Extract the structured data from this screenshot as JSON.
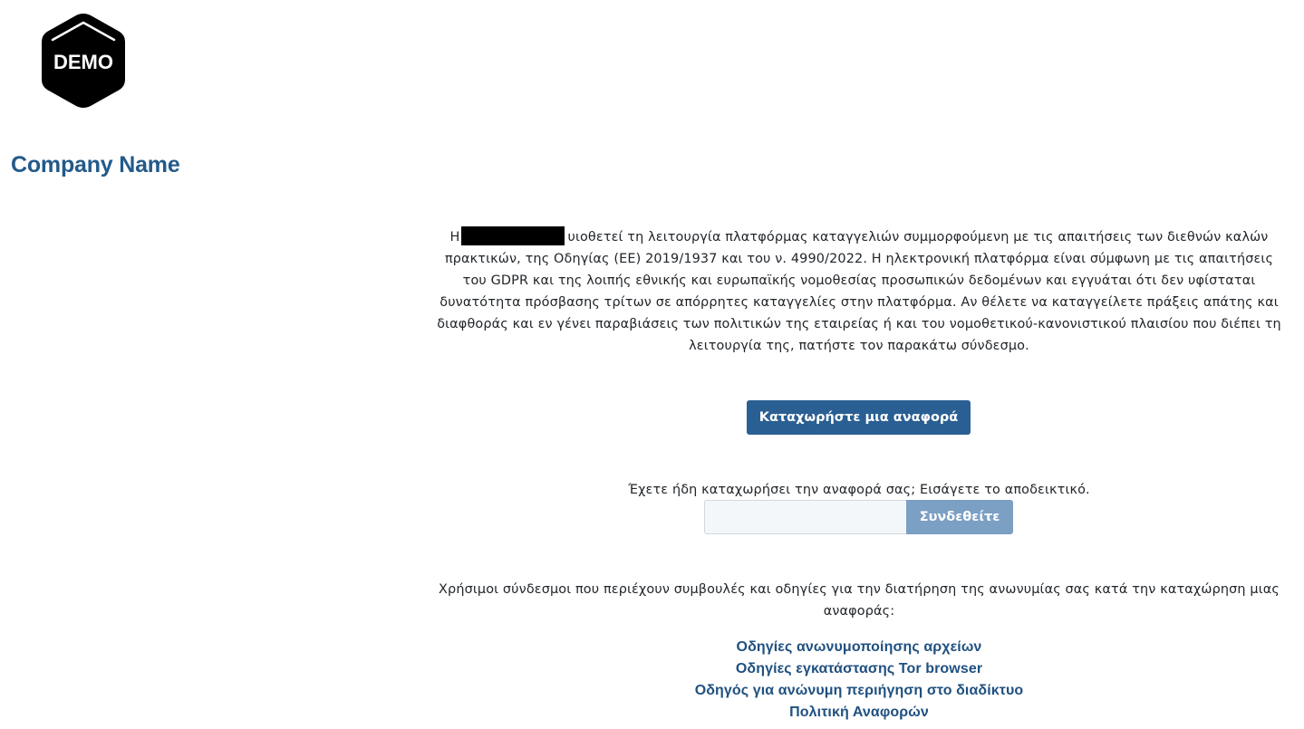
{
  "logo": {
    "text": "DEMO"
  },
  "company": {
    "name": "Company Name"
  },
  "intro": {
    "prefix": "Η",
    "text": "υιοθετεί τη λειτουργία πλατφόρμας καταγγελιών συμμορφούμενη με τις απαιτήσεις των διεθνών καλών πρακτικών, της Οδηγίας (ΕΕ) 2019/1937 και του ν. 4990/2022. Η ηλεκτρονική πλατφόρμα είναι σύμφωνη με τις απαιτήσεις του GDPR και της λοιπής εθνικής και ευρωπαϊκής νομοθεσίας προσωπικών δεδομένων και εγγυάται ότι δεν υφίσταται δυνατότητα πρόσβασης τρίτων σε απόρρητες καταγγελίες στην πλατφόρμα. Αν θέλετε να καταγγείλετε πράξεις απάτης και διαφθοράς και εν γένει παραβιάσεις των πολιτικών της εταιρείας ή και του νομοθετικού-κανονιστικού πλαισίου που διέπει τη λειτουργία της, πατήστε τον παρακάτω σύνδεσμο."
  },
  "report_button": {
    "label": "Καταχωρήστε μια αναφορά"
  },
  "login": {
    "prompt": "Έχετε ήδη καταχωρήσει την αναφορά σας; Εισάγετε το αποδεικτικό.",
    "input_value": "",
    "input_placeholder": "",
    "button_label": "Συνδεθείτε"
  },
  "useful_links": {
    "intro": "Χρήσιμοι σύνδεσμοι που περιέχουν συμβουλές και οδηγίες για την διατήρηση της ανωνυμίας σας κατά την καταχώρηση μιας αναφοράς:",
    "items": [
      {
        "label": "Οδηγίες ανωνυμοποίησης αρχείων"
      },
      {
        "label": "Οδηγίες εγκατάστασης Tor browser"
      },
      {
        "label": "Οδηγός για ανώνυμη περιήγηση στο διαδίκτυο"
      },
      {
        "label": "Πολιτική Αναφορών"
      }
    ]
  },
  "colors": {
    "brand": "#235a8a",
    "primary_button": "#2a5f93",
    "secondary_button": "#7c9fc4",
    "link": "#1f5080",
    "logo_bg": "#000000"
  }
}
